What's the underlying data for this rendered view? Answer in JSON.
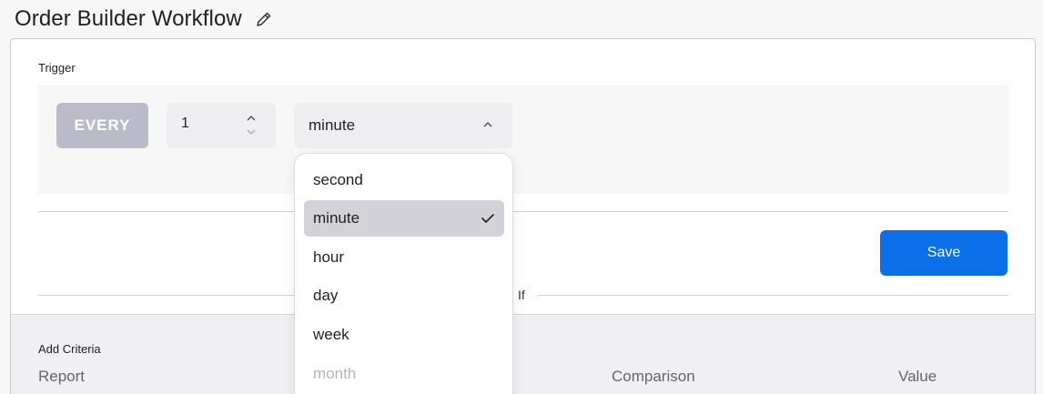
{
  "header": {
    "title": "Order Builder Workflow",
    "edit_icon": "pencil-icon"
  },
  "trigger": {
    "label": "Trigger",
    "every_label": "EVERY",
    "interval_value": "1",
    "unit_value": "minute",
    "unit_options": [
      {
        "label": "second",
        "selected": false
      },
      {
        "label": "minute",
        "selected": true
      },
      {
        "label": "hour",
        "selected": false
      },
      {
        "label": "day",
        "selected": false
      },
      {
        "label": "week",
        "selected": false
      },
      {
        "label": "month",
        "selected": false
      }
    ]
  },
  "actions": {
    "save_label": "Save"
  },
  "condition": {
    "if_label": "If"
  },
  "criteria": {
    "title": "Add Criteria",
    "columns": {
      "report": "Report",
      "comparison": "Comparison",
      "value": "Value"
    }
  },
  "colors": {
    "primary": "#0a6fe8",
    "every_bg": "#babac9",
    "selected_option_bg": "#d3d2d8"
  }
}
